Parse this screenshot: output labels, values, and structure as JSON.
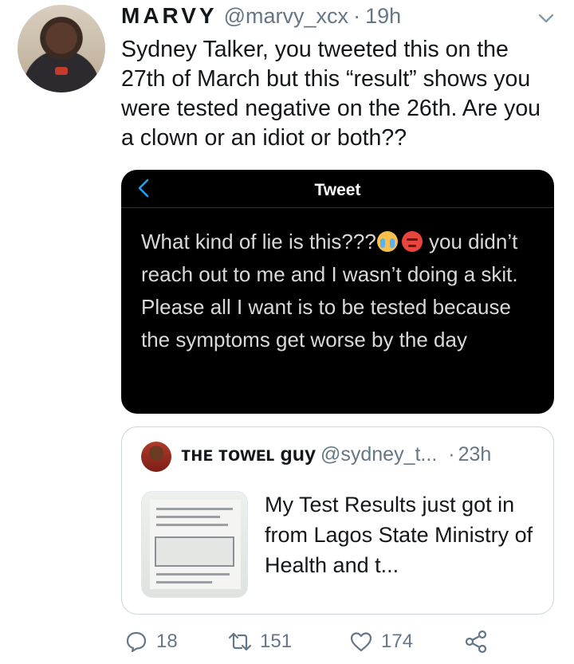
{
  "tweet": {
    "display_name": "MARVY",
    "handle": "@marvy_xcx",
    "separator": "·",
    "time": "19h",
    "text": "Sydney Talker, you tweeted this on the 27th of March but this “result” shows you were tested negative on the 26th. Are you a clown or an idiot or both??"
  },
  "media": {
    "header_title": "Tweet",
    "text_part1": "What kind of lie is this???",
    "text_part2": " you didn’t reach out to me and I wasn’t doing a skit. Please all I want is to be tested because the symptoms get worse by the day"
  },
  "quoted_tweet": {
    "display_name": "ᴛʜᴇ ᴛᴏᴡᴇʟ guy",
    "handle": "@sydney_t...",
    "separator": "·",
    "time": "23h",
    "text": "My Test Results just got in from Lagos State Ministry of Health and t..."
  },
  "actions": {
    "replies": "18",
    "retweets": "151",
    "likes": "174"
  },
  "icons": {
    "options": "chevron-down-icon",
    "back": "chevron-left-icon",
    "reply": "comment-icon",
    "retweet": "retweet-icon",
    "like": "heart-icon",
    "share": "share-icon",
    "emoji_1": "loudly-crying-face-emoji",
    "emoji_2": "angry-face-emoji"
  },
  "colors": {
    "text": "#14171a",
    "secondary": "#657786",
    "border": "#ccd6dd",
    "back_link": "#1da1f2"
  }
}
